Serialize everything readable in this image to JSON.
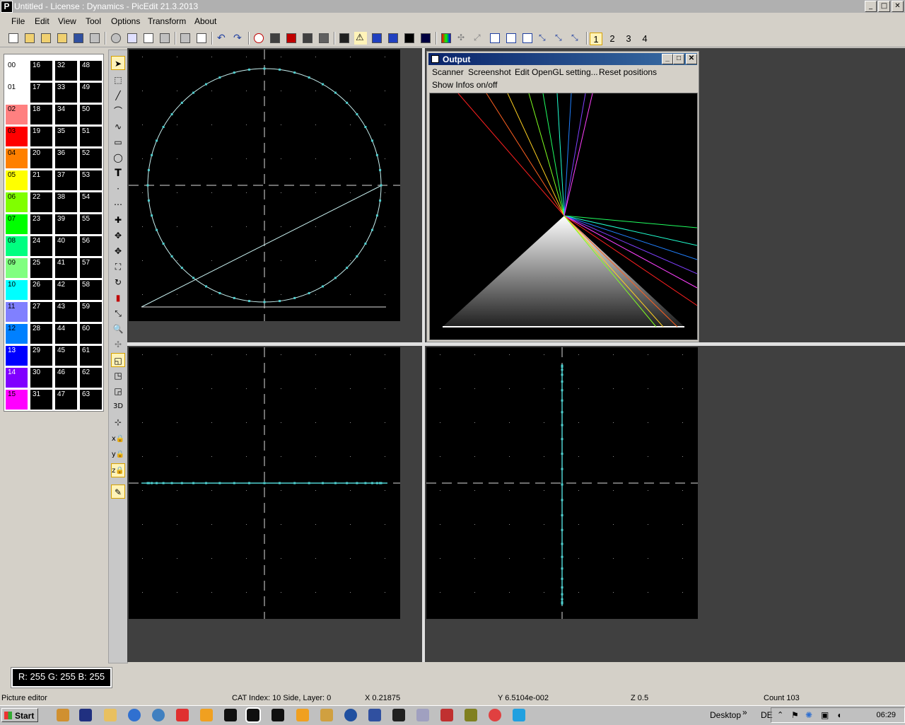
{
  "window": {
    "title": "Untitled  -  License : Dynamics -  PicEdit 21.3.2013",
    "app_letter": "P",
    "controls": {
      "minimize": "_",
      "maximize": "□",
      "close": "✕"
    }
  },
  "menu": {
    "items": [
      {
        "label": "File"
      },
      {
        "label": "Edit"
      },
      {
        "label": "View"
      },
      {
        "label": "Tool"
      },
      {
        "label": "Options"
      },
      {
        "label": "Transform"
      },
      {
        "label": "About"
      }
    ]
  },
  "toolbar": {
    "pages": [
      "1",
      "2",
      "3",
      "4"
    ],
    "active_page": "1"
  },
  "palette": {
    "swatches": [
      {
        "label": "00",
        "color": "#ffffff",
        "text": "#000000"
      },
      {
        "label": "01",
        "color": "#ffffff",
        "text": "#000000"
      },
      {
        "label": "02",
        "color": "#ff8080",
        "text": "#000000"
      },
      {
        "label": "03",
        "color": "#ff0000",
        "text": "#000000"
      },
      {
        "label": "04",
        "color": "#ff8000",
        "text": "#000000"
      },
      {
        "label": "05",
        "color": "#ffff00",
        "text": "#000000"
      },
      {
        "label": "06",
        "color": "#80ff00",
        "text": "#000000"
      },
      {
        "label": "07",
        "color": "#00ff00",
        "text": "#000000"
      },
      {
        "label": "08",
        "color": "#00ff80",
        "text": "#000000"
      },
      {
        "label": "09",
        "color": "#80ff80",
        "text": "#000000"
      },
      {
        "label": "10",
        "color": "#00ffff",
        "text": "#000000"
      },
      {
        "label": "11",
        "color": "#8080ff",
        "text": "#000000"
      },
      {
        "label": "12",
        "color": "#0080ff",
        "text": "#000000"
      },
      {
        "label": "13",
        "color": "#0000ff",
        "text": "#ffffff"
      },
      {
        "label": "14",
        "color": "#8000ff",
        "text": "#ffffff"
      },
      {
        "label": "15",
        "color": "#ff00ff",
        "text": "#000000"
      },
      {
        "label": "16"
      },
      {
        "label": "17"
      },
      {
        "label": "18"
      },
      {
        "label": "19"
      },
      {
        "label": "20"
      },
      {
        "label": "21"
      },
      {
        "label": "22"
      },
      {
        "label": "23"
      },
      {
        "label": "24"
      },
      {
        "label": "25"
      },
      {
        "label": "26"
      },
      {
        "label": "27"
      },
      {
        "label": "28"
      },
      {
        "label": "29"
      },
      {
        "label": "30"
      },
      {
        "label": "31"
      },
      {
        "label": "32"
      },
      {
        "label": "33"
      },
      {
        "label": "34"
      },
      {
        "label": "35"
      },
      {
        "label": "36"
      },
      {
        "label": "37"
      },
      {
        "label": "38"
      },
      {
        "label": "39"
      },
      {
        "label": "40"
      },
      {
        "label": "41"
      },
      {
        "label": "42"
      },
      {
        "label": "43"
      },
      {
        "label": "44"
      },
      {
        "label": "45"
      },
      {
        "label": "46"
      },
      {
        "label": "47"
      },
      {
        "label": "48"
      },
      {
        "label": "49"
      },
      {
        "label": "50"
      },
      {
        "label": "51"
      },
      {
        "label": "52"
      },
      {
        "label": "53"
      },
      {
        "label": "54"
      },
      {
        "label": "55"
      },
      {
        "label": "56"
      },
      {
        "label": "57"
      },
      {
        "label": "58"
      },
      {
        "label": "59"
      },
      {
        "label": "60"
      },
      {
        "label": "61"
      },
      {
        "label": "62"
      },
      {
        "label": "63"
      }
    ]
  },
  "tools": {
    "text_tool": "T",
    "three_d": "3D"
  },
  "output_window": {
    "title": "Output",
    "menu": [
      {
        "label": "Scanner"
      },
      {
        "label": "Screenshot"
      },
      {
        "label": "Edit OpenGL setting..."
      },
      {
        "label": "Reset positions"
      },
      {
        "label": "Show Infos on/off"
      }
    ],
    "controls": {
      "minimize": "_",
      "maximize": "□",
      "close": "✕"
    }
  },
  "color_readout": "R: 255 G: 255 B: 255",
  "status": {
    "mode": "Picture editor",
    "cat_index": "CAT Index: 10 Side, Layer: 0",
    "x": "X 0.21875",
    "y": "Y 6.5104e-002",
    "z": "Z 0.5",
    "count": "Count 103"
  },
  "taskbar": {
    "start": "Start",
    "desktop": "Desktop",
    "chevron": "»",
    "language": "DE",
    "clock": "06:29"
  },
  "colors": {
    "point_color": "#4fd0d0",
    "line_color": "#c8f0f0"
  }
}
